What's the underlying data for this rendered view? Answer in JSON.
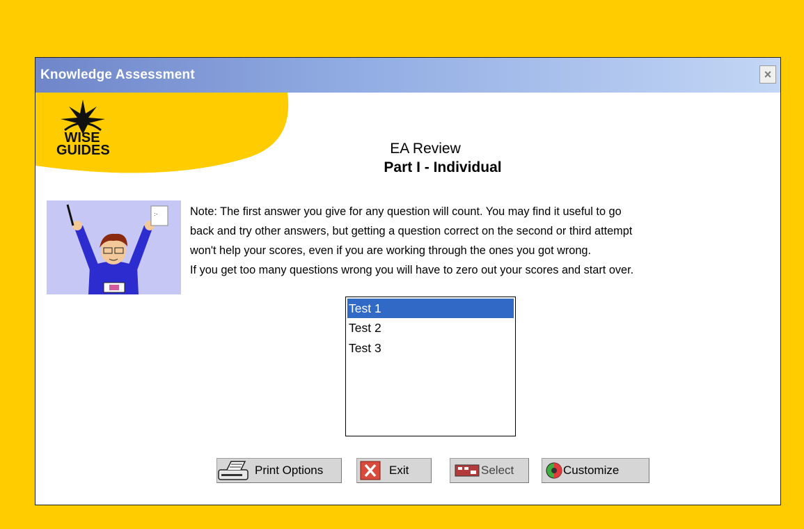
{
  "window": {
    "title": "Knowledge Assessment",
    "close_label": "×"
  },
  "logo": {
    "line1": "WISE",
    "line2": "GUIDES"
  },
  "heading": {
    "line1": "EA Review",
    "line2": "Part I - Individual"
  },
  "note": {
    "lines": [
      "Note: The first answer you give for any question will count. You may find it useful to go",
      "back and try other answers,  but getting a question correct on the second or third attempt",
      "won't help your scores, even if you are working through the ones you got wrong.",
      "If you get too many questions wrong you will have to zero out your scores and start over."
    ]
  },
  "tests": {
    "items": [
      "Test 1",
      "Test 2",
      "Test 3"
    ],
    "selected": "Test 1"
  },
  "buttons": {
    "print": "Print Options",
    "exit": "Exit",
    "select": "Select",
    "customize": "Customize"
  },
  "colors": {
    "background": "#ffcc00",
    "titlebar_start": "#6f86c9",
    "titlebar_end": "#c3d6f5",
    "selection": "#3169c6"
  }
}
